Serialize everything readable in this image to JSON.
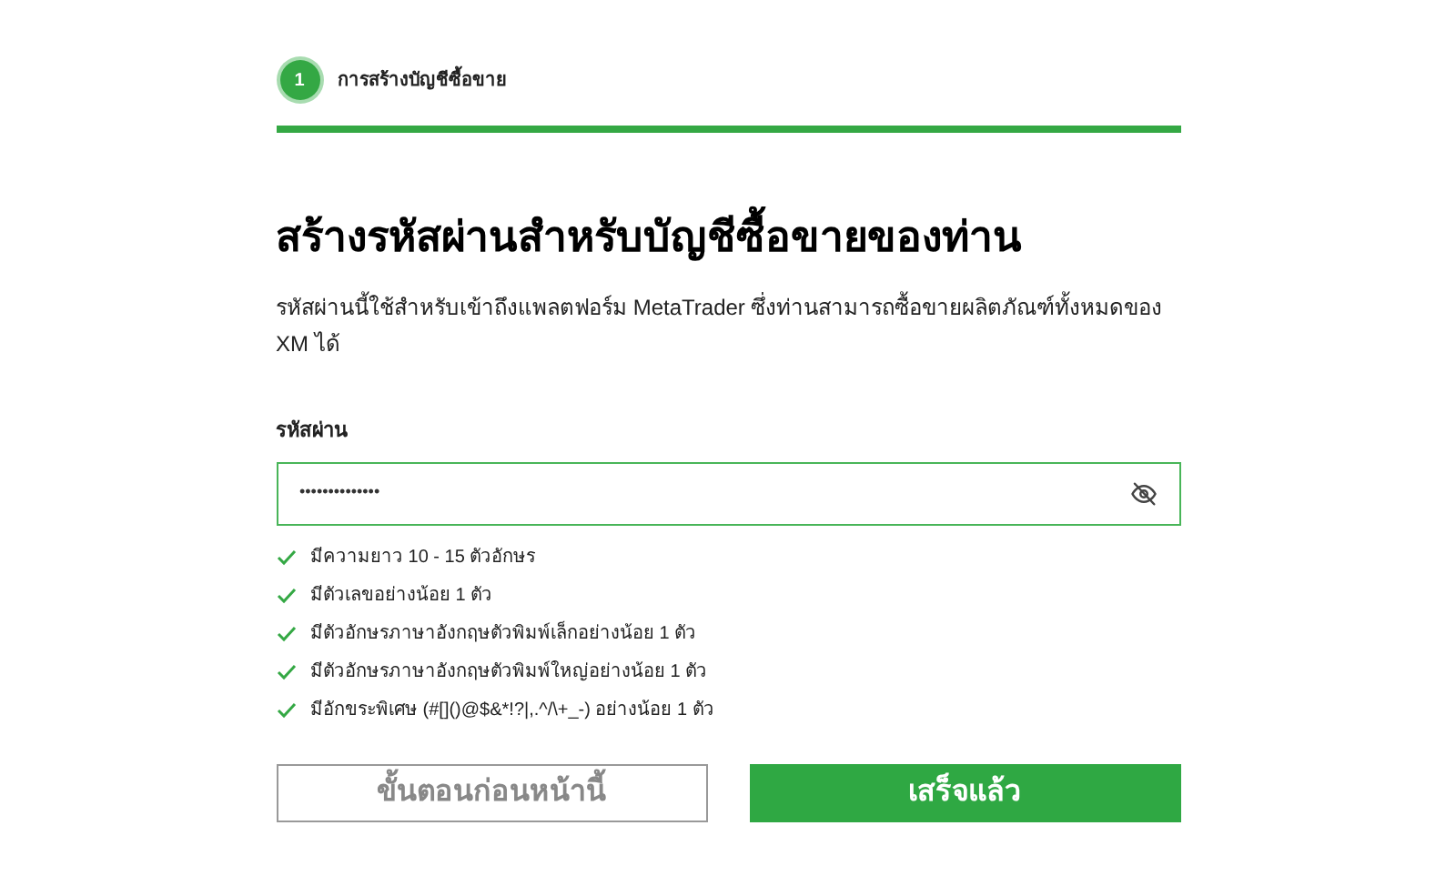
{
  "step": {
    "number": "1",
    "label": "การสร้างบัญชีซื้อขาย",
    "active": true
  },
  "progress": {
    "level": 1
  },
  "title": "สร้างรหัสผ่านสำหรับบัญชีซื้อขายของท่าน",
  "description": "รหัสผ่านนี้ใช้สำหรับเข้าถึงแพลตฟอร์ม MetaTrader ซึ่งท่านสามารถซื้อขายผลิตภัณฑ์ทั้งหมดของ XM ได้",
  "password": {
    "label": "รหัสผ่าน",
    "value": "••••••••••••••"
  },
  "rules": [
    {
      "text": "มีความยาว 10 - 15 ตัวอักษร",
      "met": true
    },
    {
      "text": "มีตัวเลขอย่างน้อย 1 ตัว",
      "met": true
    },
    {
      "text": "มีตัวอักษรภาษาอังกฤษตัวพิมพ์เล็กอย่างน้อย 1 ตัว",
      "met": true
    },
    {
      "text": "มีตัวอักษรภาษาอังกฤษตัวพิมพ์ใหญ่อย่างน้อย 1 ตัว",
      "met": true
    },
    {
      "text": "มีอักขระพิเศษ (#[]()@$&*!?|,.^/\\+_-) อย่างน้อย 1 ตัว",
      "met": true
    }
  ],
  "buttons": {
    "back": "ขั้นตอนก่อนหน้านี้",
    "done": "เสร็จแล้ว"
  }
}
